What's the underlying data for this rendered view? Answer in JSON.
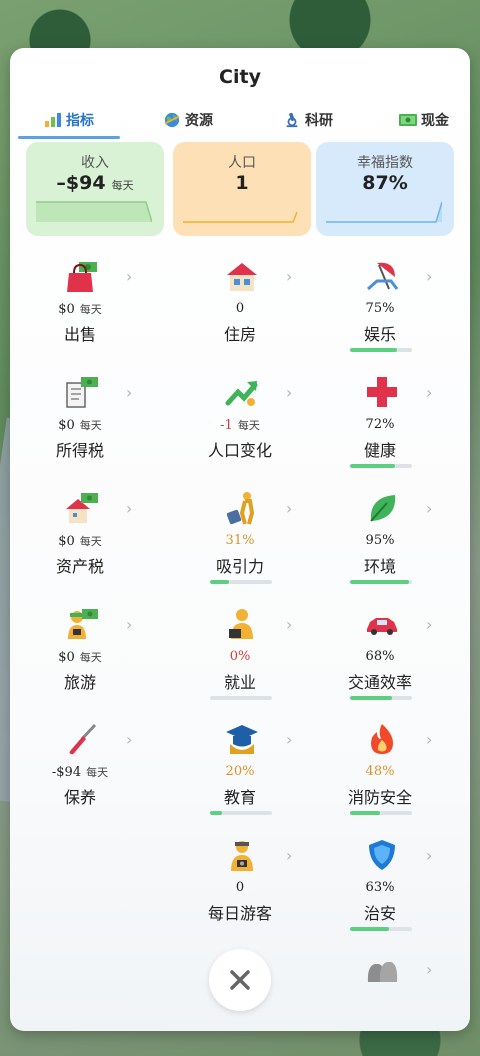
{
  "title": "City",
  "tabs": [
    {
      "label": "指标",
      "icon": "bar-chart-icon",
      "active": true
    },
    {
      "label": "资源",
      "icon": "globe-icon",
      "active": false
    },
    {
      "label": "科研",
      "icon": "microscope-icon",
      "active": false
    },
    {
      "label": "现金",
      "icon": "cash-icon",
      "active": false
    }
  ],
  "cards": {
    "income": {
      "label": "收入",
      "value": "–$94",
      "unit": "每天",
      "color": "#d9f2d6"
    },
    "population": {
      "label": "人口",
      "value": "1",
      "color": "#fde0b6"
    },
    "happiness": {
      "label": "幸福指数",
      "value": "87%",
      "color": "#d6eafb"
    }
  },
  "per_day": "每天",
  "colors": {
    "bar_fill": "#5ccf80",
    "bar_track": "#dde2e6",
    "red": "#d14040",
    "orange": "#d9932b",
    "tab_active": "#2a76c2"
  },
  "stats": {
    "sales": {
      "value": "$0",
      "name": "出售",
      "icon": "shopping-bag-icon"
    },
    "housing": {
      "value": "0",
      "name": "住房",
      "icon": "house-icon"
    },
    "entertainment": {
      "value": "75%",
      "name": "娱乐",
      "icon": "beach-umbrella-icon",
      "level": 0.75
    },
    "income_tax": {
      "value": "$0",
      "name": "所得税",
      "icon": "document-cash-icon"
    },
    "population_change": {
      "value": "-1",
      "name": "人口变化",
      "icon": "trend-up-icon"
    },
    "health": {
      "value": "72%",
      "name": "健康",
      "icon": "red-cross-icon",
      "level": 0.72
    },
    "property_tax": {
      "value": "$0",
      "name": "资产税",
      "icon": "house-cash-icon"
    },
    "attraction": {
      "value": "31%",
      "name": "吸引力",
      "icon": "traveler-icon",
      "level": 0.31
    },
    "environment": {
      "value": "95%",
      "name": "环境",
      "icon": "leaf-icon",
      "level": 0.95
    },
    "tourism": {
      "value": "$0",
      "name": "旅游",
      "icon": "tourist-cash-icon"
    },
    "employment": {
      "value": "0%",
      "name": "就业",
      "icon": "worker-icon",
      "level": 0.0
    },
    "traffic": {
      "value": "68%",
      "name": "交通效率",
      "icon": "car-icon",
      "level": 0.68
    },
    "maintenance": {
      "value": "-$94",
      "name": "保养",
      "icon": "screwdriver-icon"
    },
    "education": {
      "value": "20%",
      "name": "教育",
      "icon": "graduation-cap-icon",
      "level": 0.2
    },
    "fire_safety": {
      "value": "48%",
      "name": "消防安全",
      "icon": "fire-icon",
      "level": 0.48
    },
    "daily_visitors": {
      "value": "0",
      "name": "每日游客",
      "icon": "tourist-icon"
    },
    "security": {
      "value": "63%",
      "name": "治安",
      "icon": "shield-icon",
      "level": 0.63
    }
  },
  "close": {
    "icon": "close-icon"
  },
  "more": {
    "icon": "bags-icon"
  }
}
